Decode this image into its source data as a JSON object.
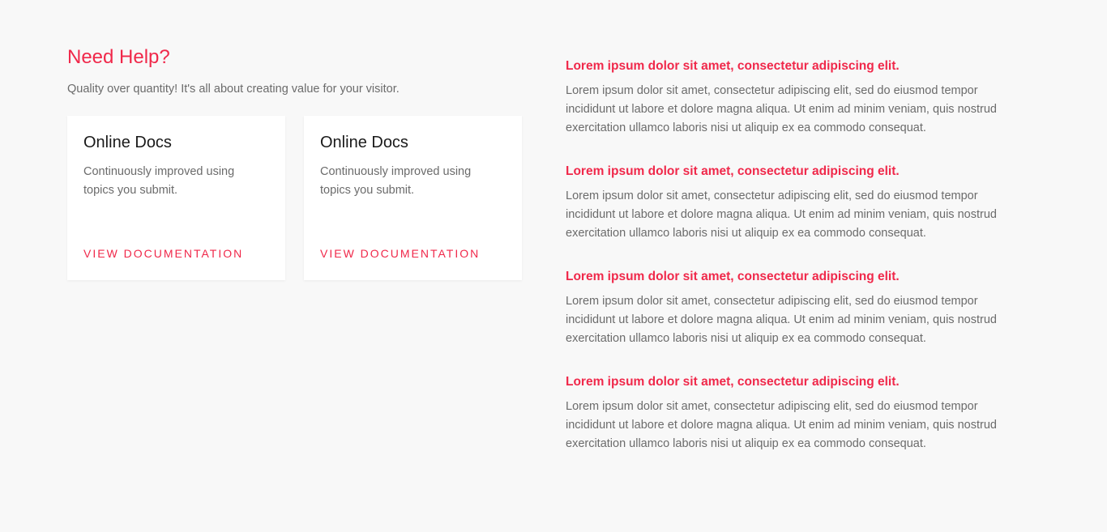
{
  "help": {
    "heading": "Need Help?",
    "subtitle": "Quality over quantity! It's all about creating value for your visitor."
  },
  "cards": [
    {
      "title": "Online Docs",
      "text": "Continuously improved using topics you submit.",
      "link": "VIEW DOCUMENTATION"
    },
    {
      "title": "Online Docs",
      "text": "Continuously improved using topics you submit.",
      "link": "VIEW DOCUMENTATION"
    }
  ],
  "faq": [
    {
      "question": "Lorem ipsum dolor sit amet, consectetur adipiscing elit.",
      "answer": "Lorem ipsum dolor sit amet, consectetur adipiscing elit, sed do eiusmod tempor incididunt ut labore et dolore magna aliqua. Ut enim ad minim veniam, quis nostrud exercitation ullamco laboris nisi ut aliquip ex ea commodo consequat."
    },
    {
      "question": "Lorem ipsum dolor sit amet, consectetur adipiscing elit.",
      "answer": "Lorem ipsum dolor sit amet, consectetur adipiscing elit, sed do eiusmod tempor incididunt ut labore et dolore magna aliqua. Ut enim ad minim veniam, quis nostrud exercitation ullamco laboris nisi ut aliquip ex ea commodo consequat."
    },
    {
      "question": "Lorem ipsum dolor sit amet, consectetur adipiscing elit.",
      "answer": "Lorem ipsum dolor sit amet, consectetur adipiscing elit, sed do eiusmod tempor incididunt ut labore et dolore magna aliqua. Ut enim ad minim veniam, quis nostrud exercitation ullamco laboris nisi ut aliquip ex ea commodo consequat."
    },
    {
      "question": "Lorem ipsum dolor sit amet, consectetur adipiscing elit.",
      "answer": "Lorem ipsum dolor sit amet, consectetur adipiscing elit, sed do eiusmod tempor incididunt ut labore et dolore magna aliqua. Ut enim ad minim veniam, quis nostrud exercitation ullamco laboris nisi ut aliquip ex ea commodo consequat."
    }
  ],
  "colors": {
    "accent": "#f0284a",
    "background": "#f8f8f8",
    "card": "#ffffff",
    "body_text": "#6b6b6b"
  }
}
